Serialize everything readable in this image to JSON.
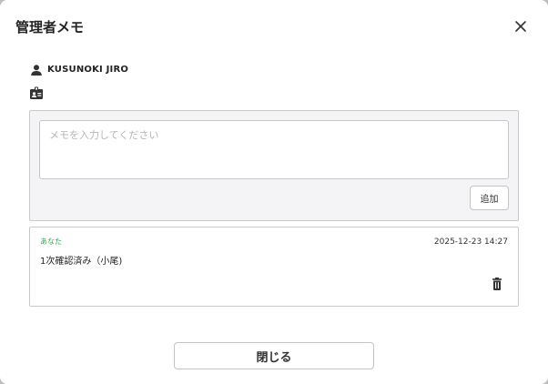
{
  "modal": {
    "title": "管理者メモ",
    "close_icon": "close-icon"
  },
  "user": {
    "icon": "person-icon",
    "name": "KUSUNOKI JIRO",
    "badge_icon": "id-badge-icon"
  },
  "memo_input": {
    "placeholder": "メモを入力してください",
    "value": "",
    "add_label": "追加"
  },
  "memos": [
    {
      "author": "あなた",
      "timestamp": "2025-12-23 14:27",
      "text": "1次確認済み（小尾)",
      "delete_icon": "trash-icon"
    }
  ],
  "footer": {
    "close_label": "閉じる"
  },
  "colors": {
    "author_accent": "#2fa84f",
    "panel_bg": "#f4f4f6",
    "border": "#c9c9cc"
  }
}
